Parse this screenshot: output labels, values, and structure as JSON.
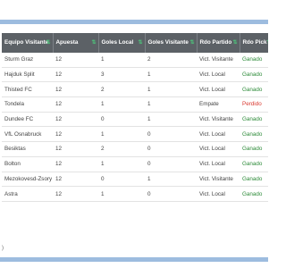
{
  "table": {
    "columns": [
      {
        "label": "Equipo Visitante",
        "sort_icon": "⇅"
      },
      {
        "label": "Apuesta",
        "sort_icon": "⇅"
      },
      {
        "label": "Goles Local",
        "sort_icon": "⇅"
      },
      {
        "label": "Goles Visitante",
        "sort_icon": "⇅"
      },
      {
        "label": "Rdo Partido",
        "sort_icon": "⇅"
      },
      {
        "label": "Rdo Pick",
        "sort_icon": "⇅"
      }
    ],
    "rows": [
      {
        "team": "Sturm Graz",
        "bet": "12",
        "home_goals": "1",
        "away_goals": "2",
        "match_result": "Vict. Visitante",
        "pick_result": "Ganado"
      },
      {
        "team": "Hajduk Split",
        "bet": "12",
        "home_goals": "3",
        "away_goals": "1",
        "match_result": "Vict. Local",
        "pick_result": "Ganado"
      },
      {
        "team": "Thisted FC",
        "bet": "12",
        "home_goals": "2",
        "away_goals": "1",
        "match_result": "Vict. Local",
        "pick_result": "Ganado"
      },
      {
        "team": "Tondela",
        "bet": "12",
        "home_goals": "1",
        "away_goals": "1",
        "match_result": "Empate",
        "pick_result": "Perdido"
      },
      {
        "team": "Dundee FC",
        "bet": "12",
        "home_goals": "0",
        "away_goals": "1",
        "match_result": "Vict. Visitante",
        "pick_result": "Ganado"
      },
      {
        "team": "VfL Osnabruck",
        "bet": "12",
        "home_goals": "1",
        "away_goals": "0",
        "match_result": "Vict. Local",
        "pick_result": "Ganado"
      },
      {
        "team": "Besiktas",
        "bet": "12",
        "home_goals": "2",
        "away_goals": "0",
        "match_result": "Vict. Local",
        "pick_result": "Ganado"
      },
      {
        "team": "Bolton",
        "bet": "12",
        "home_goals": "1",
        "away_goals": "0",
        "match_result": "Vict. Local",
        "pick_result": "Ganado"
      },
      {
        "team": "Mezokovesd-Zsory",
        "bet": "12",
        "home_goals": "0",
        "away_goals": "1",
        "match_result": "Vict. Visitante",
        "pick_result": "Ganado"
      },
      {
        "team": "Astra",
        "bet": "12",
        "home_goals": "1",
        "away_goals": "0",
        "match_result": "Vict. Local",
        "pick_result": "Ganado"
      }
    ]
  },
  "footnote": ")",
  "colors": {
    "header_bg": "#5c6166",
    "sort_icon": "#4fbf7a",
    "won": "#2e8b3a",
    "lost": "#d9382f",
    "band": "#9dbcdf"
  }
}
